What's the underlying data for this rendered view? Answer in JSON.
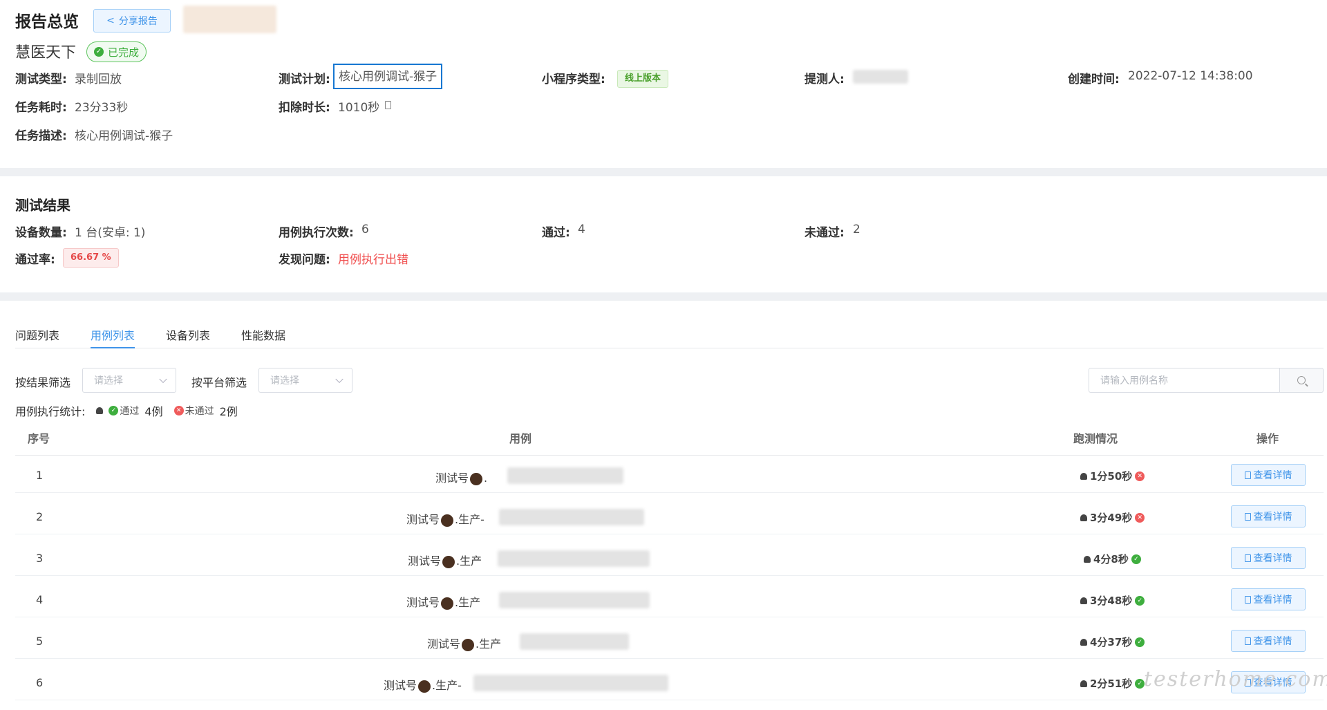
{
  "overview": {
    "title": "报告总览",
    "share_label": "分享报告",
    "app_name": "慧医天下",
    "status": "已完成",
    "fields": {
      "test_type_label": "测试类型:",
      "test_type_value": "录制回放",
      "test_plan_label": "测试计划:",
      "test_plan_value": "核心用例调试-猴子",
      "mini_type_label": "小程序类型:",
      "mini_type_value": "线上版本",
      "submitter_label": "提测人:",
      "created_label": "创建时间:",
      "created_value": "2022-07-12 14:38:00",
      "duration_label": "任务耗时:",
      "duration_value": "23分33秒",
      "deduct_label": "扣除时长:",
      "deduct_value": "1010秒",
      "desc_label": "任务描述:",
      "desc_value": "核心用例调试-猴子"
    }
  },
  "results": {
    "title": "测试结果",
    "device_count_label": "设备数量:",
    "device_count_value": "1 台(安卓: 1)",
    "exec_count_label": "用例执行次数:",
    "exec_count_value": "6",
    "pass_label": "通过:",
    "pass_value": "4",
    "fail_label": "未通过:",
    "fail_value": "2",
    "rate_label": "通过率:",
    "rate_value": "66.67 %",
    "issues_label": "发现问题:",
    "issues_value": "用例执行出错"
  },
  "tabs": [
    "问题列表",
    "用例列表",
    "设备列表",
    "性能数据"
  ],
  "active_tab": 1,
  "filters": {
    "result_label": "按结果筛选",
    "result_placeholder": "请选择",
    "platform_label": "按平台筛选",
    "platform_placeholder": "请选择",
    "search_placeholder": "请输入用例名称"
  },
  "stats": {
    "label": "用例执行统计:",
    "pass_text": "通过",
    "pass_count": "4例",
    "fail_text": "未通过",
    "fail_count": "2例"
  },
  "table": {
    "headers": [
      "序号",
      "用例",
      "跑测情况",
      "操作"
    ],
    "detail_label": "查看详情",
    "rows": [
      {
        "index": "1",
        "case_prefix": "测试号",
        "case_suffix": ".",
        "duration": "1分50秒",
        "passed": false
      },
      {
        "index": "2",
        "case_prefix": "测试号",
        "case_suffix": ".生产-",
        "duration": "3分49秒",
        "passed": false
      },
      {
        "index": "3",
        "case_prefix": "测试号",
        "case_suffix": ".生产",
        "duration": "4分8秒",
        "passed": true
      },
      {
        "index": "4",
        "case_prefix": "测试号",
        "case_suffix": ".生产",
        "duration": "3分48秒",
        "passed": true
      },
      {
        "index": "5",
        "case_prefix": "测试号",
        "case_suffix": ".生产",
        "duration": "4分37秒",
        "passed": true
      },
      {
        "index": "6",
        "case_prefix": "测试号",
        "case_suffix": ".生产-",
        "duration": "2分51秒",
        "passed": true
      }
    ]
  },
  "watermark": "testerhome.com",
  "colors": {
    "accent": "#3f94e9",
    "success": "#3eae3e",
    "danger": "#ef5b5b"
  }
}
